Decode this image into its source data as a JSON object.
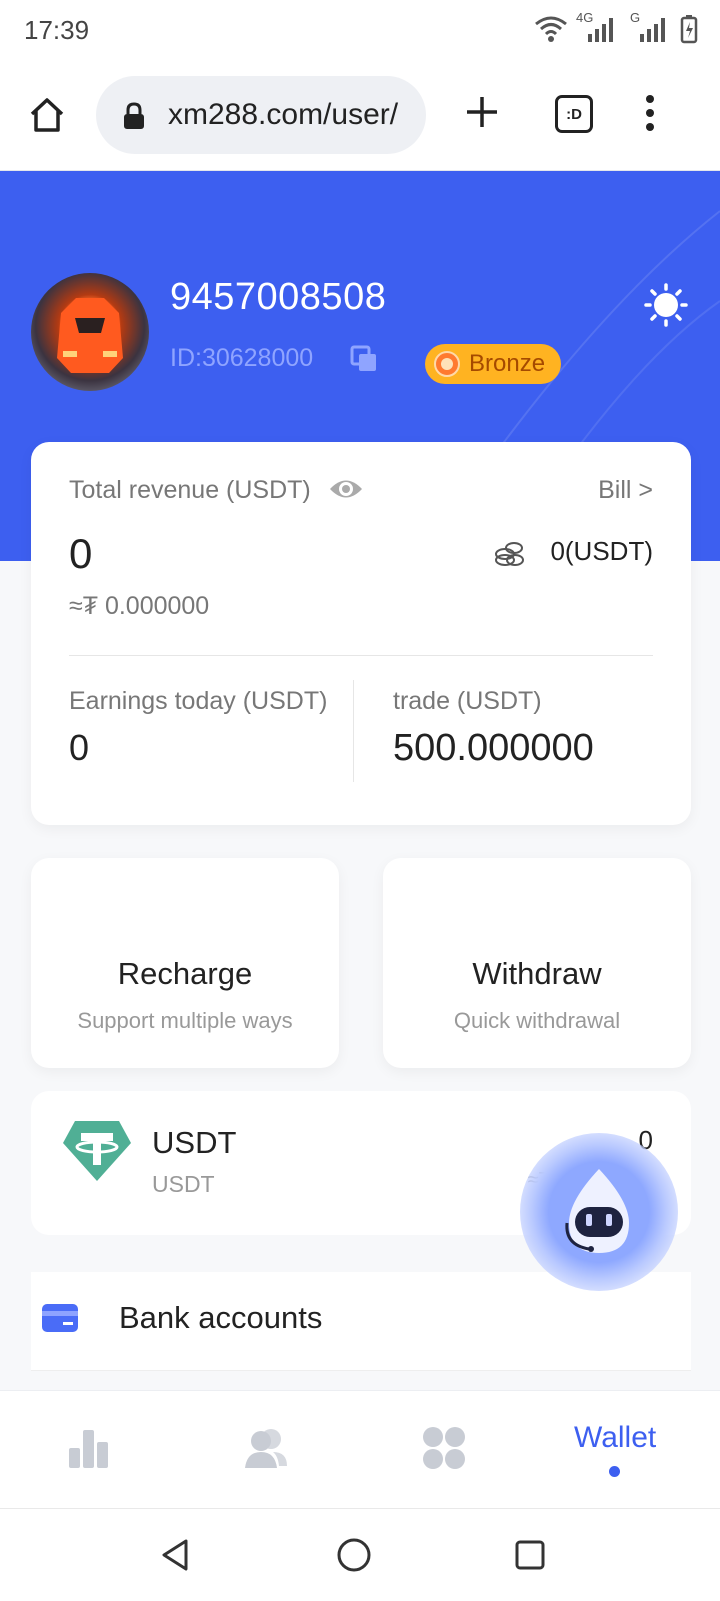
{
  "status_bar": {
    "time": "17:39",
    "net_4g": "4G",
    "net_g": "G"
  },
  "browser": {
    "url": "xm288.com/user/",
    "tab_glyph": ":D"
  },
  "profile": {
    "username": "9457008508",
    "user_id": "ID:30628000",
    "badge": "Bronze"
  },
  "revenue": {
    "total_label": "Total revenue (USDT)",
    "bill_link": "Bill >",
    "total_value": "0",
    "total_approx": "≈₮ 0.000000",
    "coins_value": "0(USDT)",
    "earnings_label": "Earnings today (USDT)",
    "earnings_value": "0",
    "trade_label": "trade (USDT)",
    "trade_value": "500.000000"
  },
  "actions": [
    {
      "title": "Recharge",
      "subtitle": "Support multiple ways"
    },
    {
      "title": "Withdraw",
      "subtitle": "Quick withdrawal"
    }
  ],
  "asset": {
    "name": "USDT",
    "sub": "USDT",
    "amount": "0",
    "approx": "≈₮"
  },
  "bank": {
    "label": "Bank accounts"
  },
  "bottom_nav": {
    "active_label": "Wallet"
  },
  "colors": {
    "accent": "#3d5ff0",
    "badge": "#ffb321",
    "tether": "#50af95"
  }
}
